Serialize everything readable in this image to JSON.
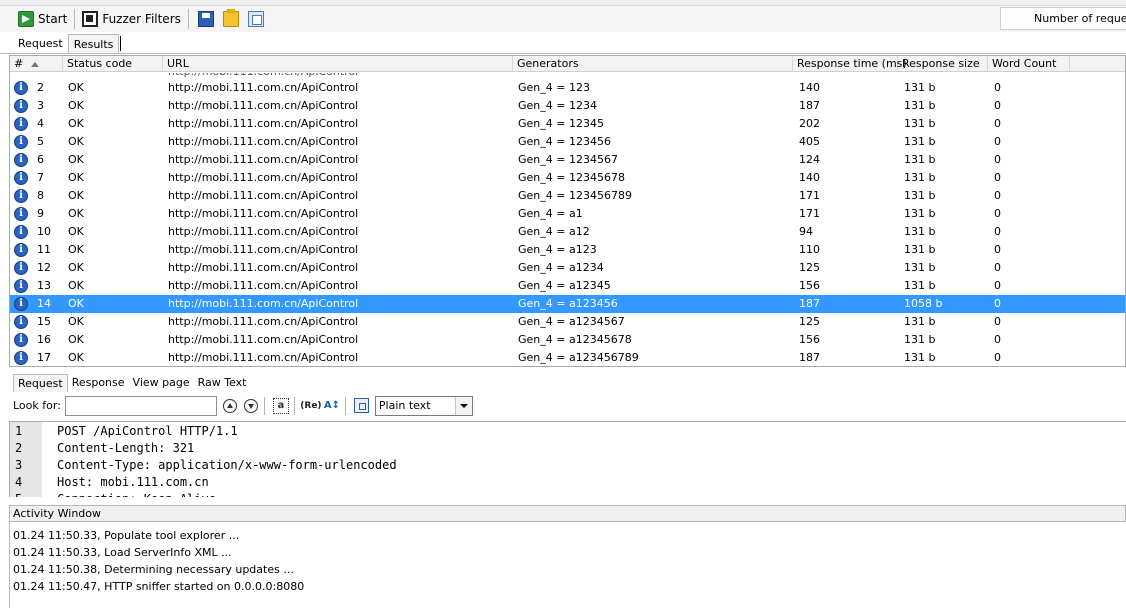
{
  "toolbar": {
    "start_label": "Start",
    "fuzzer_filters_label": "Fuzzer Filters"
  },
  "num_requests_label": "Number of requests",
  "main_tabs": [
    {
      "label": "Request",
      "active": false
    },
    {
      "label": "Results",
      "active": true
    }
  ],
  "grid": {
    "columns": [
      "#",
      "Status code",
      "URL",
      "Generators",
      "Response time (ms)",
      "Response size",
      "Word Count"
    ],
    "rows": [
      {
        "num": "2",
        "status": "OK",
        "url": "http://mobi.111.com.cn/ApiControl",
        "gen": "Gen_4 = 123",
        "time": "140",
        "size": "131 b",
        "words": "0"
      },
      {
        "num": "3",
        "status": "OK",
        "url": "http://mobi.111.com.cn/ApiControl",
        "gen": "Gen_4 = 1234",
        "time": "187",
        "size": "131 b",
        "words": "0"
      },
      {
        "num": "4",
        "status": "OK",
        "url": "http://mobi.111.com.cn/ApiControl",
        "gen": "Gen_4 = 12345",
        "time": "202",
        "size": "131 b",
        "words": "0"
      },
      {
        "num": "5",
        "status": "OK",
        "url": "http://mobi.111.com.cn/ApiControl",
        "gen": "Gen_4 = 123456",
        "time": "405",
        "size": "131 b",
        "words": "0"
      },
      {
        "num": "6",
        "status": "OK",
        "url": "http://mobi.111.com.cn/ApiControl",
        "gen": "Gen_4 = 1234567",
        "time": "124",
        "size": "131 b",
        "words": "0"
      },
      {
        "num": "7",
        "status": "OK",
        "url": "http://mobi.111.com.cn/ApiControl",
        "gen": "Gen_4 = 12345678",
        "time": "140",
        "size": "131 b",
        "words": "0"
      },
      {
        "num": "8",
        "status": "OK",
        "url": "http://mobi.111.com.cn/ApiControl",
        "gen": "Gen_4 = 123456789",
        "time": "171",
        "size": "131 b",
        "words": "0"
      },
      {
        "num": "9",
        "status": "OK",
        "url": "http://mobi.111.com.cn/ApiControl",
        "gen": "Gen_4 = a1",
        "time": "171",
        "size": "131 b",
        "words": "0"
      },
      {
        "num": "10",
        "status": "OK",
        "url": "http://mobi.111.com.cn/ApiControl",
        "gen": "Gen_4 = a12",
        "time": "94",
        "size": "131 b",
        "words": "0"
      },
      {
        "num": "11",
        "status": "OK",
        "url": "http://mobi.111.com.cn/ApiControl",
        "gen": "Gen_4 = a123",
        "time": "110",
        "size": "131 b",
        "words": "0"
      },
      {
        "num": "12",
        "status": "OK",
        "url": "http://mobi.111.com.cn/ApiControl",
        "gen": "Gen_4 = a1234",
        "time": "125",
        "size": "131 b",
        "words": "0"
      },
      {
        "num": "13",
        "status": "OK",
        "url": "http://mobi.111.com.cn/ApiControl",
        "gen": "Gen_4 = a12345",
        "time": "156",
        "size": "131 b",
        "words": "0"
      },
      {
        "num": "14",
        "status": "OK",
        "url": "http://mobi.111.com.cn/ApiControl",
        "gen": "Gen_4 = a123456",
        "time": "187",
        "size": "1058 b",
        "words": "0",
        "selected": true
      },
      {
        "num": "15",
        "status": "OK",
        "url": "http://mobi.111.com.cn/ApiControl",
        "gen": "Gen_4 = a1234567",
        "time": "125",
        "size": "131 b",
        "words": "0"
      },
      {
        "num": "16",
        "status": "OK",
        "url": "http://mobi.111.com.cn/ApiControl",
        "gen": "Gen_4 = a12345678",
        "time": "156",
        "size": "131 b",
        "words": "0"
      },
      {
        "num": "17",
        "status": "OK",
        "url": "http://mobi.111.com.cn/ApiControl",
        "gen": "Gen_4 = a123456789",
        "time": "187",
        "size": "131 b",
        "words": "0"
      }
    ],
    "selected_color": "#3399ff"
  },
  "lower_tabs": [
    {
      "label": "Request",
      "active": true
    },
    {
      "label": "Response",
      "active": false
    },
    {
      "label": "View page",
      "active": false
    },
    {
      "label": "Raw Text",
      "active": false
    }
  ],
  "findbar": {
    "label": "Look for:",
    "input_value": "",
    "mode_selected": "Plain text",
    "aa_glyph": "a",
    "re_glyph": "(Re)",
    "az_glyph": "A↕"
  },
  "editor": {
    "lines": [
      {
        "n": "1",
        "text": "POST /ApiControl HTTP/1.1"
      },
      {
        "n": "2",
        "text": "Content-Length: 321"
      },
      {
        "n": "3",
        "text": "Content-Type: application/x-www-form-urlencoded"
      },
      {
        "n": "4",
        "text": "Host: mobi.111.com.cn"
      },
      {
        "n": "5",
        "text": "Connection: Keep-Alive"
      }
    ]
  },
  "activity": {
    "title": "Activity Window",
    "log": [
      "01.24 11:50.33, Populate tool explorer ...",
      "01.24 11:50.33, Load ServerInfo XML ...",
      "01.24 11:50.38, Determining necessary updates ...",
      "01.24 11:50.47, HTTP sniffer started on 0.0.0.0:8080"
    ]
  }
}
